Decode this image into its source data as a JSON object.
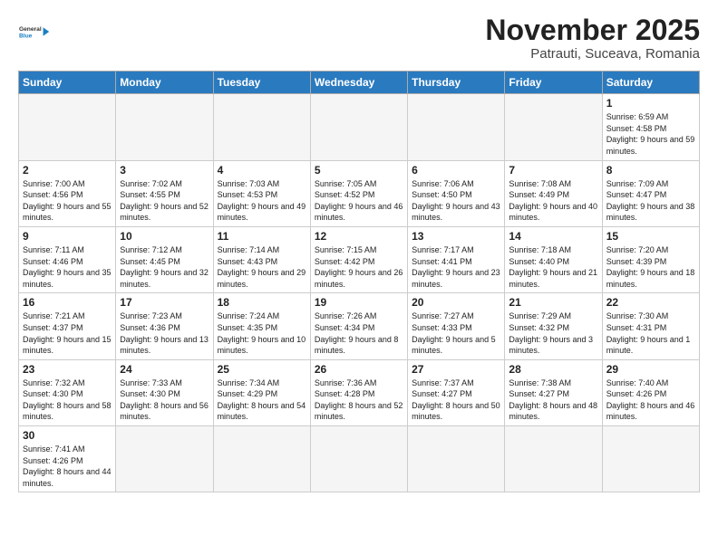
{
  "header": {
    "logo_general": "General",
    "logo_blue": "Blue",
    "title": "November 2025",
    "subtitle": "Patrauti, Suceava, Romania"
  },
  "weekdays": [
    "Sunday",
    "Monday",
    "Tuesday",
    "Wednesday",
    "Thursday",
    "Friday",
    "Saturday"
  ],
  "weeks": [
    [
      {
        "day": "",
        "sunrise": "",
        "sunset": "",
        "daylight": "",
        "empty": true
      },
      {
        "day": "",
        "sunrise": "",
        "sunset": "",
        "daylight": "",
        "empty": true
      },
      {
        "day": "",
        "sunrise": "",
        "sunset": "",
        "daylight": "",
        "empty": true
      },
      {
        "day": "",
        "sunrise": "",
        "sunset": "",
        "daylight": "",
        "empty": true
      },
      {
        "day": "",
        "sunrise": "",
        "sunset": "",
        "daylight": "",
        "empty": true
      },
      {
        "day": "",
        "sunrise": "",
        "sunset": "",
        "daylight": "",
        "empty": true
      },
      {
        "day": "1",
        "sunrise": "Sunrise: 6:59 AM",
        "sunset": "Sunset: 4:58 PM",
        "daylight": "Daylight: 9 hours and 59 minutes.",
        "empty": false
      }
    ],
    [
      {
        "day": "2",
        "sunrise": "Sunrise: 7:00 AM",
        "sunset": "Sunset: 4:56 PM",
        "daylight": "Daylight: 9 hours and 55 minutes.",
        "empty": false
      },
      {
        "day": "3",
        "sunrise": "Sunrise: 7:02 AM",
        "sunset": "Sunset: 4:55 PM",
        "daylight": "Daylight: 9 hours and 52 minutes.",
        "empty": false
      },
      {
        "day": "4",
        "sunrise": "Sunrise: 7:03 AM",
        "sunset": "Sunset: 4:53 PM",
        "daylight": "Daylight: 9 hours and 49 minutes.",
        "empty": false
      },
      {
        "day": "5",
        "sunrise": "Sunrise: 7:05 AM",
        "sunset": "Sunset: 4:52 PM",
        "daylight": "Daylight: 9 hours and 46 minutes.",
        "empty": false
      },
      {
        "day": "6",
        "sunrise": "Sunrise: 7:06 AM",
        "sunset": "Sunset: 4:50 PM",
        "daylight": "Daylight: 9 hours and 43 minutes.",
        "empty": false
      },
      {
        "day": "7",
        "sunrise": "Sunrise: 7:08 AM",
        "sunset": "Sunset: 4:49 PM",
        "daylight": "Daylight: 9 hours and 40 minutes.",
        "empty": false
      },
      {
        "day": "8",
        "sunrise": "Sunrise: 7:09 AM",
        "sunset": "Sunset: 4:47 PM",
        "daylight": "Daylight: 9 hours and 38 minutes.",
        "empty": false
      }
    ],
    [
      {
        "day": "9",
        "sunrise": "Sunrise: 7:11 AM",
        "sunset": "Sunset: 4:46 PM",
        "daylight": "Daylight: 9 hours and 35 minutes.",
        "empty": false
      },
      {
        "day": "10",
        "sunrise": "Sunrise: 7:12 AM",
        "sunset": "Sunset: 4:45 PM",
        "daylight": "Daylight: 9 hours and 32 minutes.",
        "empty": false
      },
      {
        "day": "11",
        "sunrise": "Sunrise: 7:14 AM",
        "sunset": "Sunset: 4:43 PM",
        "daylight": "Daylight: 9 hours and 29 minutes.",
        "empty": false
      },
      {
        "day": "12",
        "sunrise": "Sunrise: 7:15 AM",
        "sunset": "Sunset: 4:42 PM",
        "daylight": "Daylight: 9 hours and 26 minutes.",
        "empty": false
      },
      {
        "day": "13",
        "sunrise": "Sunrise: 7:17 AM",
        "sunset": "Sunset: 4:41 PM",
        "daylight": "Daylight: 9 hours and 23 minutes.",
        "empty": false
      },
      {
        "day": "14",
        "sunrise": "Sunrise: 7:18 AM",
        "sunset": "Sunset: 4:40 PM",
        "daylight": "Daylight: 9 hours and 21 minutes.",
        "empty": false
      },
      {
        "day": "15",
        "sunrise": "Sunrise: 7:20 AM",
        "sunset": "Sunset: 4:39 PM",
        "daylight": "Daylight: 9 hours and 18 minutes.",
        "empty": false
      }
    ],
    [
      {
        "day": "16",
        "sunrise": "Sunrise: 7:21 AM",
        "sunset": "Sunset: 4:37 PM",
        "daylight": "Daylight: 9 hours and 15 minutes.",
        "empty": false
      },
      {
        "day": "17",
        "sunrise": "Sunrise: 7:23 AM",
        "sunset": "Sunset: 4:36 PM",
        "daylight": "Daylight: 9 hours and 13 minutes.",
        "empty": false
      },
      {
        "day": "18",
        "sunrise": "Sunrise: 7:24 AM",
        "sunset": "Sunset: 4:35 PM",
        "daylight": "Daylight: 9 hours and 10 minutes.",
        "empty": false
      },
      {
        "day": "19",
        "sunrise": "Sunrise: 7:26 AM",
        "sunset": "Sunset: 4:34 PM",
        "daylight": "Daylight: 9 hours and 8 minutes.",
        "empty": false
      },
      {
        "day": "20",
        "sunrise": "Sunrise: 7:27 AM",
        "sunset": "Sunset: 4:33 PM",
        "daylight": "Daylight: 9 hours and 5 minutes.",
        "empty": false
      },
      {
        "day": "21",
        "sunrise": "Sunrise: 7:29 AM",
        "sunset": "Sunset: 4:32 PM",
        "daylight": "Daylight: 9 hours and 3 minutes.",
        "empty": false
      },
      {
        "day": "22",
        "sunrise": "Sunrise: 7:30 AM",
        "sunset": "Sunset: 4:31 PM",
        "daylight": "Daylight: 9 hours and 1 minute.",
        "empty": false
      }
    ],
    [
      {
        "day": "23",
        "sunrise": "Sunrise: 7:32 AM",
        "sunset": "Sunset: 4:30 PM",
        "daylight": "Daylight: 8 hours and 58 minutes.",
        "empty": false
      },
      {
        "day": "24",
        "sunrise": "Sunrise: 7:33 AM",
        "sunset": "Sunset: 4:30 PM",
        "daylight": "Daylight: 8 hours and 56 minutes.",
        "empty": false
      },
      {
        "day": "25",
        "sunrise": "Sunrise: 7:34 AM",
        "sunset": "Sunset: 4:29 PM",
        "daylight": "Daylight: 8 hours and 54 minutes.",
        "empty": false
      },
      {
        "day": "26",
        "sunrise": "Sunrise: 7:36 AM",
        "sunset": "Sunset: 4:28 PM",
        "daylight": "Daylight: 8 hours and 52 minutes.",
        "empty": false
      },
      {
        "day": "27",
        "sunrise": "Sunrise: 7:37 AM",
        "sunset": "Sunset: 4:27 PM",
        "daylight": "Daylight: 8 hours and 50 minutes.",
        "empty": false
      },
      {
        "day": "28",
        "sunrise": "Sunrise: 7:38 AM",
        "sunset": "Sunset: 4:27 PM",
        "daylight": "Daylight: 8 hours and 48 minutes.",
        "empty": false
      },
      {
        "day": "29",
        "sunrise": "Sunrise: 7:40 AM",
        "sunset": "Sunset: 4:26 PM",
        "daylight": "Daylight: 8 hours and 46 minutes.",
        "empty": false
      }
    ],
    [
      {
        "day": "30",
        "sunrise": "Sunrise: 7:41 AM",
        "sunset": "Sunset: 4:26 PM",
        "daylight": "Daylight: 8 hours and 44 minutes.",
        "empty": false
      },
      {
        "day": "",
        "sunrise": "",
        "sunset": "",
        "daylight": "",
        "empty": true
      },
      {
        "day": "",
        "sunrise": "",
        "sunset": "",
        "daylight": "",
        "empty": true
      },
      {
        "day": "",
        "sunrise": "",
        "sunset": "",
        "daylight": "",
        "empty": true
      },
      {
        "day": "",
        "sunrise": "",
        "sunset": "",
        "daylight": "",
        "empty": true
      },
      {
        "day": "",
        "sunrise": "",
        "sunset": "",
        "daylight": "",
        "empty": true
      },
      {
        "day": "",
        "sunrise": "",
        "sunset": "",
        "daylight": "",
        "empty": true
      }
    ]
  ]
}
